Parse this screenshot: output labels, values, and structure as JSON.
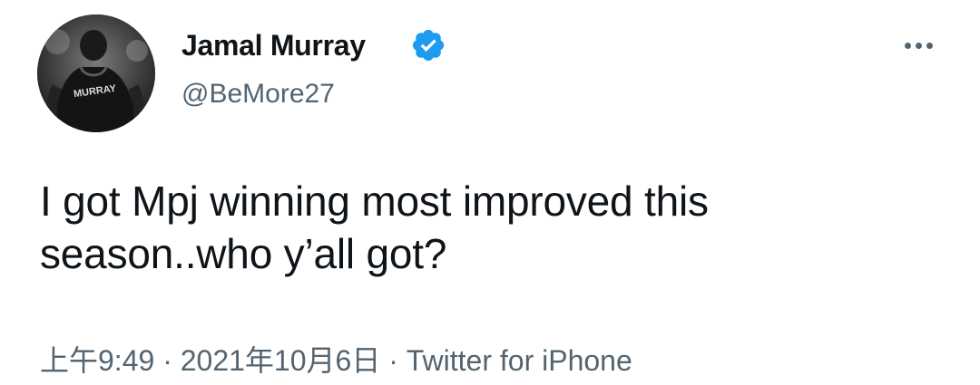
{
  "tweet": {
    "author": {
      "name": "Jamal Murray",
      "handle": "@BeMore27",
      "verified": true,
      "avatar_jersey_text": "MURRAY"
    },
    "text": "I got Mpj winning most improved this\nseason..who y’all got?",
    "timestamp": {
      "time": "上午9:49",
      "separator": " · ",
      "date": "2021年10月6日",
      "source": "Twitter for iPhone"
    },
    "colors": {
      "verified_badge": "#1d9bf0",
      "secondary_text": "#536471",
      "primary_text": "#0f1419"
    }
  }
}
